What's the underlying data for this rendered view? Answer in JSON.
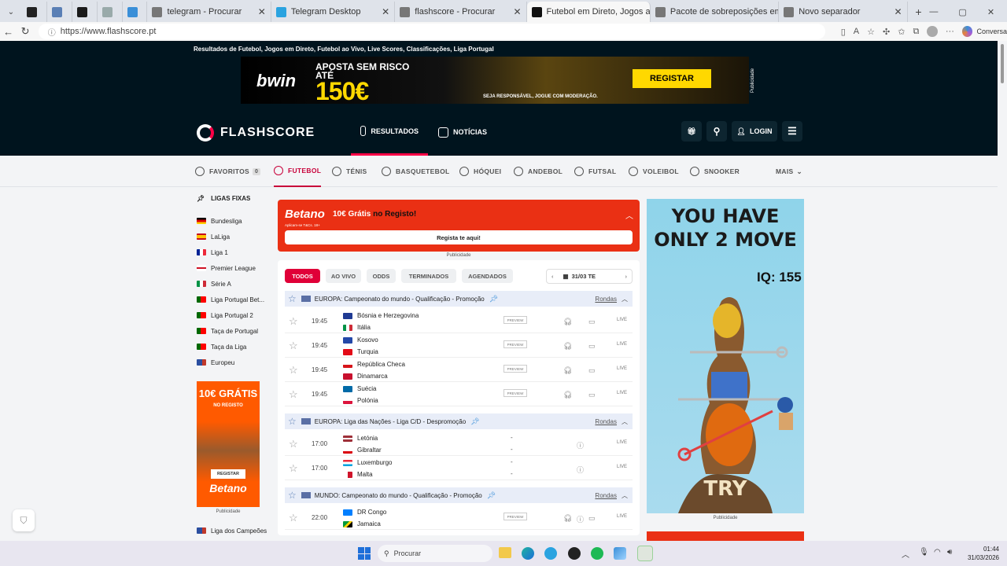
{
  "browser": {
    "tabs": [
      {
        "label": "",
        "icon": "bp-favicon-icon",
        "color": "#222"
      },
      {
        "label": "",
        "icon": "image-favicon-icon",
        "color": "#5a7fb5"
      },
      {
        "label": "",
        "icon": "k-favicon-icon",
        "color": "#1a1a1a"
      },
      {
        "label": "",
        "icon": "globe-favicon-icon",
        "color": "#9aa"
      },
      {
        "label": "",
        "icon": "refresh-favicon-icon",
        "color": "#3a8fd8"
      },
      {
        "label": "telegram - Procurar",
        "icon": "search-icon",
        "color": "#777"
      },
      {
        "label": "Telegram Desktop",
        "icon": "telegram-icon",
        "color": "#2aa3e0"
      },
      {
        "label": "flashscore - Procurar",
        "icon": "search-icon",
        "color": "#777"
      },
      {
        "label": "Futebol em Direto, Jogos ao Vivo",
        "icon": "flashscore-icon",
        "color": "#111"
      },
      {
        "label": "Pacote de sobreposições em pre",
        "icon": "doc-icon",
        "color": "#777"
      },
      {
        "label": "Novo separador",
        "icon": "page-icon",
        "color": "#777"
      }
    ],
    "url": "https://www.flashscore.pt",
    "profile_label": "Conversa"
  },
  "topline": "Resultados de Futebol, Jogos em Direto, Futebol ao Vivo, Live Scores, Classificações, Liga Portugal",
  "top_banner": {
    "brand": "bwin",
    "line1": "APOSTA SEM RISCO",
    "line2": "ATÉ",
    "amount": "150€",
    "button": "REGISTAR",
    "disclaimer": "SEJA RESPONSÁVEL, JOGUE COM MODERAÇÃO.",
    "side": "Publicidade"
  },
  "header": {
    "logo": "FLASHSCORE",
    "nav": [
      "RESULTADOS",
      "NOTÍCIAS"
    ],
    "login": "LOGIN"
  },
  "sports": [
    {
      "label": "FAVORITOS",
      "count": "0"
    },
    {
      "label": "FUTEBOL"
    },
    {
      "label": "TÉNIS"
    },
    {
      "label": "BASQUETEBOL"
    },
    {
      "label": "HÓQUEI"
    },
    {
      "label": "ANDEBOL"
    },
    {
      "label": "FUTSAL"
    },
    {
      "label": "VOLEIBOL"
    },
    {
      "label": "SNOOKER"
    },
    {
      "label": "MAIS"
    }
  ],
  "left": {
    "title": "LIGAS FIXAS",
    "leagues": [
      {
        "name": "Bundesliga",
        "flag": "linear-gradient(#000 33%,#d00 33%,#d00 66%,#ffce00 66%)"
      },
      {
        "name": "LaLiga",
        "flag": "linear-gradient(#c60b1e 25%,#ffc400 25%,#ffc400 75%,#c60b1e 75%)"
      },
      {
        "name": "Liga 1",
        "flag": "linear-gradient(90deg,#002395 33%,#fff 33%,#fff 66%,#ed2939 66%)"
      },
      {
        "name": "Premier League",
        "flag": "linear-gradient(#fff 40%,#ce1124 40%,#ce1124 60%,#fff 60%)"
      },
      {
        "name": "Série A",
        "flag": "linear-gradient(90deg,#009246 33%,#fff 33%,#fff 66%,#ce2b37 66%)"
      },
      {
        "name": "Liga Portugal Bet...",
        "flag": "linear-gradient(90deg,#006600 40%,#ff0000 40%)"
      },
      {
        "name": "Liga Portugal 2",
        "flag": "linear-gradient(90deg,#006600 40%,#ff0000 40%)"
      },
      {
        "name": "Taça de Portugal",
        "flag": "linear-gradient(90deg,#006600 40%,#ff0000 40%)"
      },
      {
        "name": "Taça da Liga",
        "flag": "linear-gradient(90deg,#006600 40%,#ff0000 40%)"
      },
      {
        "name": "Europeu",
        "flag": "linear-gradient(90deg,#2a4ea0 60%,#c0392b 60%)"
      }
    ],
    "ad": {
      "title": "10€ GRÁTIS",
      "sub": "NO REGISTO",
      "button": "REGISTAR",
      "brand": "Betano",
      "pub": "Publicidade"
    },
    "after_ad": "Liga dos Campeões"
  },
  "betano_banner": {
    "brand": "Betano",
    "offer_a": "10€ Grátis",
    "offer_b": "no Registo!",
    "small": "Aplicam-se T&Cs. 18+",
    "button": "Regista te aqui!",
    "pub": "Publicidade"
  },
  "filters": [
    "TODOS",
    "AO VIVO",
    "ODDS",
    "TERMINADOS",
    "AGENDADOS"
  ],
  "date": "31/03 TE",
  "groups": [
    {
      "title": "EUROPA: Campeonato do mundo - Qualificação - Promoção",
      "rondas": "Rondas",
      "matches": [
        {
          "time": "19:45",
          "home": "Bósnia e Herzegovina",
          "away": "Itália",
          "preview": "PREVIEW",
          "live": "LIVE",
          "hf": "#1f3a93",
          "af": "linear-gradient(90deg,#009246 33%,#fff 33%,#fff 66%,#ce2b37 66%)"
        },
        {
          "time": "19:45",
          "home": "Kosovo",
          "away": "Turquia",
          "preview": "PREVIEW",
          "live": "LIVE",
          "hf": "#2448a8",
          "af": "#e30a17"
        },
        {
          "time": "19:45",
          "home": "República Checa",
          "away": "Dinamarca",
          "preview": "PREVIEW",
          "live": "LIVE",
          "hf": "linear-gradient(#fff 50%,#d7141a 50%)",
          "af": "#c8102e"
        },
        {
          "time": "19:45",
          "home": "Suécia",
          "away": "Polónia",
          "preview": "PREVIEW",
          "live": "LIVE",
          "hf": "#006aa7",
          "af": "linear-gradient(#fff 50%,#dc143c 50%)"
        }
      ]
    },
    {
      "title": "EUROPA: Liga das Nações - Liga C/D - Despromoção",
      "rondas": "Rondas",
      "matches": [
        {
          "time": "17:00",
          "home": "Letónia",
          "away": "Gibraltar",
          "live": "LIVE",
          "hf": "linear-gradient(#9e3039 40%,#fff 40%,#fff 60%,#9e3039 60%)",
          "af": "linear-gradient(#fff 60%,#da000c 60%)"
        },
        {
          "time": "17:00",
          "home": "Luxemburgo",
          "away": "Malta",
          "live": "LIVE",
          "hf": "linear-gradient(#ed2939 33%,#fff 33%,#fff 66%,#00a1de 66%)",
          "af": "linear-gradient(90deg,#fff 50%,#cf142b 50%)"
        }
      ]
    },
    {
      "title": "MUNDO: Campeonato do mundo - Qualificação - Promoção",
      "rondas": "Rondas",
      "matches": [
        {
          "time": "22:00",
          "home": "DR Congo",
          "away": "Jamaica",
          "preview": "PREVIEW",
          "live": "LIVE",
          "hf": "#007fff",
          "af": "linear-gradient(135deg,#009b3a 40%,#fed100 40%,#fed100 60%,#000 60%)"
        }
      ]
    }
  ],
  "right_ad": {
    "line1": "YOU HAVE",
    "line2": "ONLY 2 MOVE",
    "iq": "IQ: 155",
    "cta": "TRY",
    "pub": "Publicidade"
  },
  "taskbar": {
    "search": "Procurar",
    "time": "01:44",
    "date": "31/03/2026"
  }
}
